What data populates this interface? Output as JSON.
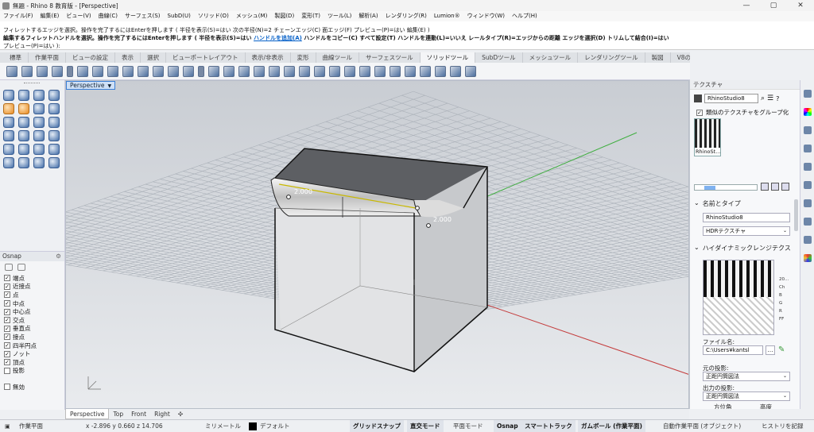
{
  "titlebar": {
    "title": "無題 - Rhino 8 教育版 - [Perspective]",
    "min": "—",
    "max": "▢",
    "close": "✕"
  },
  "menu": [
    "ファイル(F)",
    "編集(E)",
    "ビュー(V)",
    "曲線(C)",
    "サーフェス(S)",
    "SubD(U)",
    "ソリッド(O)",
    "メッシュ(M)",
    "製図(D)",
    "変形(T)",
    "ツール(L)",
    "解析(A)",
    "レンダリング(R)",
    "Lumion®",
    "ウィンドウ(W)",
    "ヘルプ(H)"
  ],
  "command": {
    "line1": "フィレットするエッジを選択。操作を完了するにはEnterを押します ( 半径を表示(S)=はい 次の半径(N)=2 チェーンエッジ(C) 面エッジ(F) プレビュー(P)=はい 編集(E) )",
    "line2a": "編集するフィレットハンドルを選択。操作を完了するにはEnterを押します ( 半径を表示(S)=はい ",
    "line2link": "ハンドルを追加(A)",
    "line2b": " ハンドルをコピー(C) すべて設定(T) ハンドルを連動(L)=いいえ レールタイプ(R)=エッジからの距離 エッジを選択(D) トリムして結合(I)=はい",
    "line3": "プレビュー(P)=はい ):"
  },
  "toolbar_tabs": [
    "標準",
    "作業平面",
    "ビューの設定",
    "表示",
    "選択",
    "ビューポートレイアウト",
    "表示/非表示",
    "変形",
    "曲線ツール",
    "サーフェスツール",
    "ソリッドツール",
    "SubDツール",
    "メッシュツール",
    "レンダリングツール",
    "製図",
    "V8の新機能"
  ],
  "active_tab": "ソリッドツール",
  "viewport": {
    "name": "Perspective",
    "radius_label_1": "2.000",
    "radius_label_2": "2.000"
  },
  "viewport_tabs": [
    "Perspective",
    "Top",
    "Front",
    "Right"
  ],
  "osnap": {
    "title": "Osnap",
    "items": [
      {
        "label": "端点",
        "checked": true
      },
      {
        "label": "近接点",
        "checked": true
      },
      {
        "label": "点",
        "checked": true
      },
      {
        "label": "中点",
        "checked": true
      },
      {
        "label": "中心点",
        "checked": true
      },
      {
        "label": "交点",
        "checked": true
      },
      {
        "label": "垂直点",
        "checked": true
      },
      {
        "label": "接点",
        "checked": true
      },
      {
        "label": "四半円点",
        "checked": true
      },
      {
        "label": "ノット",
        "checked": true
      },
      {
        "label": "頂点",
        "checked": true
      },
      {
        "label": "投影",
        "checked": false
      }
    ],
    "disable": "無効"
  },
  "texture_panel": {
    "title": "テクスチャ",
    "search_value": "RhinoStudio8",
    "group_label": "類似のテクスチャをグループ化",
    "thumb_label": "RhinoSt...",
    "name_type_header": "名前とタイプ",
    "name_value": "RhinoStudio8",
    "type_value": "HDRテクスチャ",
    "hdr_header": "ハイダイナミックレンジテクス",
    "pv_info": [
      "20...",
      "Ch",
      "B",
      "G",
      "R",
      "FF"
    ],
    "file_label": "ファイル名:",
    "file_value": "C:\\Users¥kantsl",
    "original_proj_label": "元の投影:",
    "original_proj_value": "正距円筒図法",
    "output_proj_label": "出力の投影:",
    "output_proj_value": "正距円筒図法",
    "azimuth": "方位角",
    "altitude": "高度"
  },
  "status": {
    "cplane": "作業平面",
    "coords": "x -2.896  y 0.660  z 14.706",
    "units": "ミリメートル",
    "layer": "デフォルト",
    "grid_snap": "グリッドスナップ",
    "ortho": "直交モード",
    "planar": "平面モード",
    "osnap": "Osnap",
    "smarttrack": "スマートトラック",
    "gumball": "ガムボール (作業平面)",
    "auto_cplane": "自動作業平面 (オブジェクト)",
    "history": "ヒストリを記録"
  },
  "colors": {
    "accent": "#3b7fd6",
    "link": "#0a63c9",
    "x_axis": "#c43c3c",
    "y_axis": "#3fae3f"
  }
}
